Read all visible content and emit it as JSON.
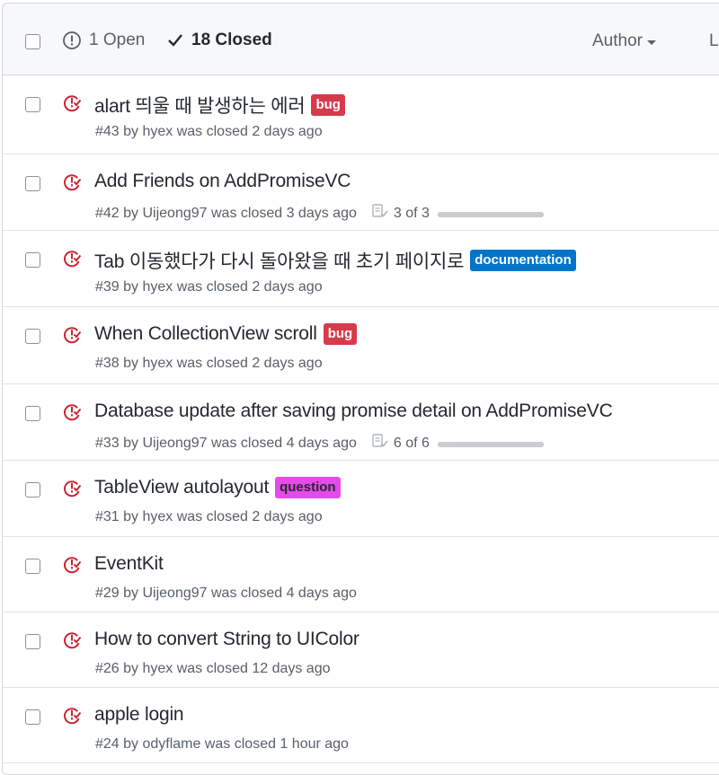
{
  "filters": {
    "open_label": "1 Open",
    "closed_label": "18 Closed",
    "author_label": "Author",
    "label_filter": "L"
  },
  "colors": {
    "closed_icon": "#cb2431",
    "bug": "#d73a4a",
    "documentation": "#0075ca",
    "question": "#e54be8"
  },
  "issues": [
    {
      "title": "alart 띄울 때 발생하는 에러",
      "meta": "#43 by hyex was closed 2 days ago",
      "label": "bug"
    },
    {
      "title": "Add Friends on AddPromiseVC",
      "meta": "#42 by Uijeong97 was closed 3 days ago",
      "tasks": "3 of 3",
      "progress": 1.0
    },
    {
      "title": "Tab 이동했다가 다시 돌아왔을 때 초기 페이지로",
      "meta": "#39 by hyex was closed 2 days ago",
      "label": "documentation"
    },
    {
      "title": "When CollectionView scroll",
      "meta": "#38 by hyex was closed 2 days ago",
      "label": "bug"
    },
    {
      "title": "Database update after saving promise detail on AddPromiseVC",
      "meta": "#33 by Uijeong97 was closed 4 days ago",
      "tasks": "6 of 6",
      "progress": 1.0
    },
    {
      "title": "TableView autolayout",
      "meta": "#31 by hyex was closed 2 days ago",
      "label": "question"
    },
    {
      "title": "EventKit",
      "meta": "#29 by Uijeong97 was closed 4 days ago"
    },
    {
      "title": "How to convert String to UIColor",
      "meta": "#26 by hyex was closed 12 days ago"
    },
    {
      "title": "apple login",
      "meta": "#24 by odyflame was closed 1 hour ago"
    }
  ]
}
